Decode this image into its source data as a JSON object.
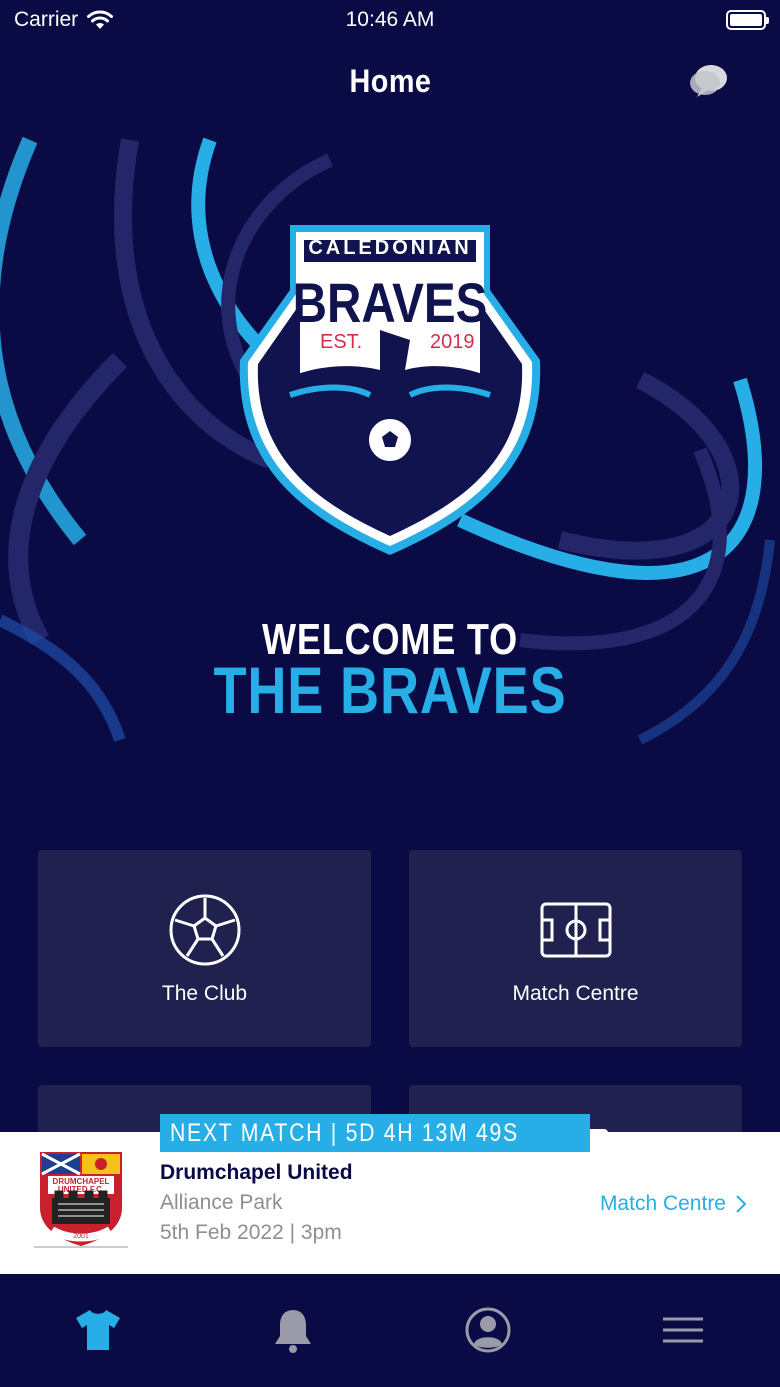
{
  "status_bar": {
    "carrier": "Carrier",
    "time": "10:46 AM"
  },
  "header": {
    "title": "Home"
  },
  "hero": {
    "crest_top": "CALEDONIAN",
    "crest_name": "BRAVES",
    "crest_est": "EST.",
    "crest_year": "2019",
    "welcome": "WELCOME TO",
    "tagline": "THE BRAVES"
  },
  "tiles": [
    {
      "label": "The Club",
      "icon": "football-icon"
    },
    {
      "label": "Match Centre",
      "icon": "pitch-icon"
    }
  ],
  "next_match": {
    "badge": "NEXT MATCH | 5D 4H 13M 49S",
    "opponent": "Drumchapel United",
    "venue": "Alliance Park",
    "datetime": "5th Feb 2022 | 3pm",
    "link_label": "Match Centre",
    "crest_text_1": "DRUMCHAPEL",
    "crest_text_2": "UNITED F.C.",
    "crest_year": "2001"
  },
  "tab_bar": [
    {
      "icon": "shirt-icon",
      "active": true
    },
    {
      "icon": "bell-icon",
      "active": false
    },
    {
      "icon": "profile-icon",
      "active": false
    },
    {
      "icon": "menu-icon",
      "active": false
    }
  ],
  "colors": {
    "background": "#0a0b45",
    "accent": "#27aee6",
    "tile": "#20214f"
  }
}
